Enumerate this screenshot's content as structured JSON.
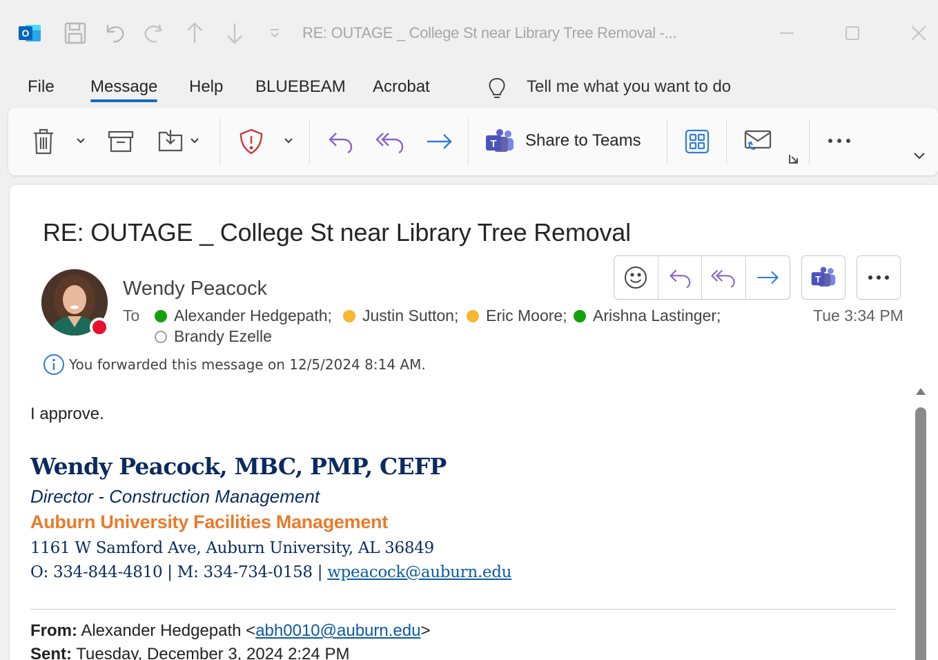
{
  "window": {
    "title": "RE: OUTAGE _ College St near Library Tree Removal  -..."
  },
  "menu": {
    "items": [
      "File",
      "Message",
      "Help",
      "BLUEBEAM",
      "Acrobat"
    ],
    "active": "Message",
    "tell_me": "Tell me what you want to do"
  },
  "ribbon": {
    "share_to_teams": "Share to Teams"
  },
  "message": {
    "subject": "RE: OUTAGE _ College St near Library Tree Removal",
    "sender": "Wendy Peacock",
    "to_label": "To",
    "recipients": [
      {
        "name": "Alexander Hedgepath;",
        "status": "available"
      },
      {
        "name": "Justin Sutton;",
        "status": "away"
      },
      {
        "name": "Eric Moore;",
        "status": "away"
      },
      {
        "name": "Arishna Lastinger;",
        "status": "available"
      },
      {
        "name": "Brandy Ezelle",
        "status": "offline"
      }
    ],
    "date": "Tue 3:34 PM",
    "info": "You forwarded this message on 12/5/2024 8:14 AM.",
    "body": "I approve.",
    "signature": {
      "name": "Wendy Peacock, MBC, PMP, CEFP",
      "title": "Director - Construction Management",
      "org": "Auburn University Facilities Management",
      "address": "1161 W Samford Ave, Auburn University, AL 36849",
      "phone_prefix": "O: 334-844-4810 | M: 334-734-0158 | ",
      "email": "wpeacock@auburn.edu"
    },
    "quoted": {
      "from_label": "From:",
      "from_name": " Alexander Hedgepath <",
      "from_email": "abh0010@auburn.edu",
      "from_suffix": ">",
      "sent_label": "Sent:",
      "sent_value": " Tuesday, December 3, 2024 2:24 PM"
    }
  },
  "colors": {
    "accent": "#0f6cbd",
    "teams": "#5b5fc7",
    "reply_purple": "#8a63c9",
    "forward_blue": "#2f7bd6",
    "sig_navy": "#0b2a5f",
    "sig_orange": "#e87b2c",
    "presence_busy": "#e8112d",
    "presence_available": "#13a10e",
    "presence_away": "#f7b731"
  }
}
